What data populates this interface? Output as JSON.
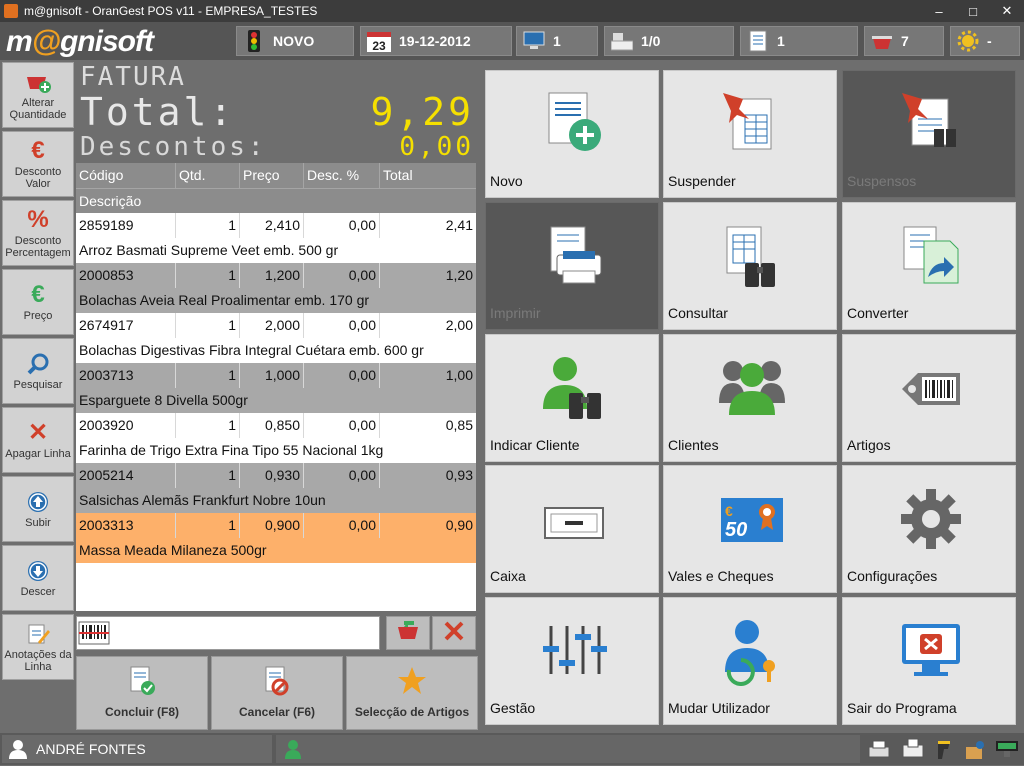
{
  "window": {
    "title": "m@gnisoft - OranGest POS v11 - EMPRESA_TESTES",
    "minimize": "–",
    "maximize": "□",
    "close": "✕"
  },
  "logo": {
    "prefix": "m",
    "at": "@",
    "suffix": "gnisoft"
  },
  "topbar": {
    "state": "NOVO",
    "date_day": "23",
    "date": "19-12-2012",
    "terminal": "1",
    "drawer": "1/0",
    "doc": "1",
    "cart": "7",
    "settings": "-"
  },
  "side_buttons": [
    {
      "label": "Alterar Quantidade",
      "icon": "cart-plus-icon"
    },
    {
      "label": "Desconto Valor",
      "icon": "euro-icon",
      "glyph": "€"
    },
    {
      "label": "Desconto Percentagem",
      "icon": "percent-icon",
      "glyph": "%"
    },
    {
      "label": "Preço",
      "icon": "euro-green-icon",
      "glyph": "€"
    },
    {
      "label": "Pesquisar",
      "icon": "search-icon"
    },
    {
      "label": "Apagar Linha",
      "icon": "delete-icon",
      "glyph": "✕"
    },
    {
      "label": "Subir",
      "icon": "arrow-up-icon"
    },
    {
      "label": "Descer",
      "icon": "arrow-down-icon"
    },
    {
      "label": "Anotações da Linha",
      "icon": "note-edit-icon"
    }
  ],
  "display": {
    "doc_type": "FATURA",
    "total_label": "Total:",
    "total_value": "9,29",
    "discount_label": "Descontos:",
    "discount_value": "0,00"
  },
  "grid": {
    "headers": [
      "Código",
      "Qtd.",
      "Preço",
      "Desc. %",
      "Total"
    ],
    "sub_header": "Descrição",
    "rows": [
      {
        "code": "2859189",
        "qty": "1",
        "price": "2,410",
        "disc": "0,00",
        "total": "2,41",
        "desc": "Arroz Basmati Supreme Veet emb. 500 gr"
      },
      {
        "code": "2000853",
        "qty": "1",
        "price": "1,200",
        "disc": "0,00",
        "total": "1,20",
        "desc": "Bolachas Aveia Real Proalimentar emb. 170 gr"
      },
      {
        "code": "2674917",
        "qty": "1",
        "price": "2,000",
        "disc": "0,00",
        "total": "2,00",
        "desc": "Bolachas Digestivas Fibra Integral Cuétara emb. 600 gr"
      },
      {
        "code": "2003713",
        "qty": "1",
        "price": "1,000",
        "disc": "0,00",
        "total": "1,00",
        "desc": "Esparguete 8  Divella 500gr"
      },
      {
        "code": "2003920",
        "qty": "1",
        "price": "0,850",
        "disc": "0,00",
        "total": "0,85",
        "desc": "Farinha de Trigo Extra Fina Tipo 55  Nacional 1kg"
      },
      {
        "code": "2005214",
        "qty": "1",
        "price": "0,930",
        "disc": "0,00",
        "total": "0,93",
        "desc": "Salsichas Alemãs Frankfurt  Nobre 10un"
      },
      {
        "code": "2003313",
        "qty": "1",
        "price": "0,900",
        "disc": "0,00",
        "total": "0,90",
        "desc": "Massa Meada  Milaneza 500gr"
      }
    ]
  },
  "scan": {
    "value": "",
    "placeholder": ""
  },
  "bottom_buttons": {
    "conclude": "Concluir (F8)",
    "cancel": "Cancelar (F6)",
    "selection": "Selecção de Artigos"
  },
  "tiles": [
    {
      "label": "Novo",
      "icon": "new-doc-icon",
      "disabled": false
    },
    {
      "label": "Suspender",
      "icon": "suspend-pin-icon",
      "disabled": false
    },
    {
      "label": "Suspensos",
      "icon": "suspended-docs-icon",
      "disabled": true
    },
    {
      "label": "Imprimir",
      "icon": "print-icon",
      "disabled": true
    },
    {
      "label": "Consultar",
      "icon": "consult-binoculars-icon",
      "disabled": false
    },
    {
      "label": "Converter",
      "icon": "convert-doc-icon",
      "disabled": false
    },
    {
      "label": "Indicar Cliente",
      "icon": "indicate-client-icon",
      "disabled": false
    },
    {
      "label": "Clientes",
      "icon": "clients-icon",
      "disabled": false
    },
    {
      "label": "Artigos",
      "icon": "barcode-tag-icon",
      "disabled": false
    },
    {
      "label": "Caixa",
      "icon": "cash-register-icon",
      "disabled": false
    },
    {
      "label": "Vales e Cheques",
      "icon": "voucher-icon",
      "disabled": false,
      "voucher_text": "50",
      "voucher_currency": "€"
    },
    {
      "label": "Configurações",
      "icon": "gear-icon",
      "disabled": false
    },
    {
      "label": "Gestão",
      "icon": "sliders-icon",
      "disabled": false
    },
    {
      "label": "Mudar Utilizador",
      "icon": "change-user-icon",
      "disabled": false
    },
    {
      "label": "Sair do Programa",
      "icon": "exit-monitor-icon",
      "disabled": false
    }
  ],
  "status": {
    "user": "ANDRÉ FONTES"
  },
  "colors": {
    "accent_orange": "#fdb06a",
    "led_yellow": "#f5e000",
    "green": "#3aaa5a",
    "red": "#d0402a",
    "blue": "#2a6fb0"
  }
}
